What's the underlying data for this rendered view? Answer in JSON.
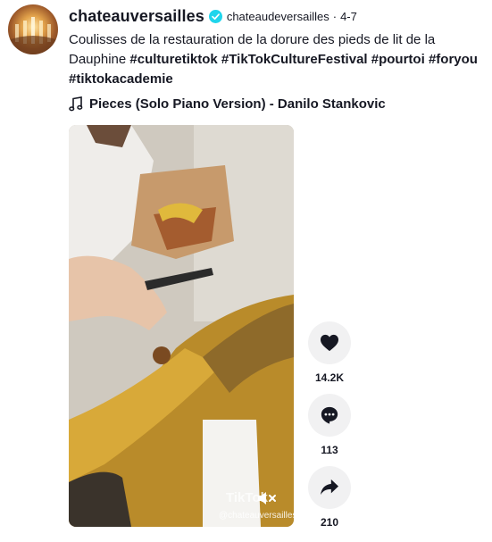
{
  "post": {
    "username": "chateauversailles",
    "nickname": "chateaudeversailles",
    "separator": "·",
    "date": "4-7",
    "description_text": "Coulisses de la restauration de la dorure des pieds de lit de la Dauphine ",
    "hashtags": [
      "#culturetiktok",
      "#TikTokCultureFestival",
      "#pourtoi",
      "#foryou",
      "#tiktokacademie"
    ],
    "music": "Pieces (Solo Piano Version) - Danilo Stankovic"
  },
  "video": {
    "watermark": "TikTok",
    "handle": "@chateauversailles"
  },
  "actions": {
    "likes": "14.2K",
    "comments": "113",
    "shares": "210"
  },
  "icons": {
    "verified": "verified-badge-icon",
    "music": "music-note-icon",
    "like": "heart-icon",
    "comment": "comment-icon",
    "share": "share-icon",
    "mute": "volume-muted-icon"
  },
  "colors": {
    "text": "#161823",
    "verified": "#20d5ec",
    "action_bg": "#f1f1f2"
  }
}
